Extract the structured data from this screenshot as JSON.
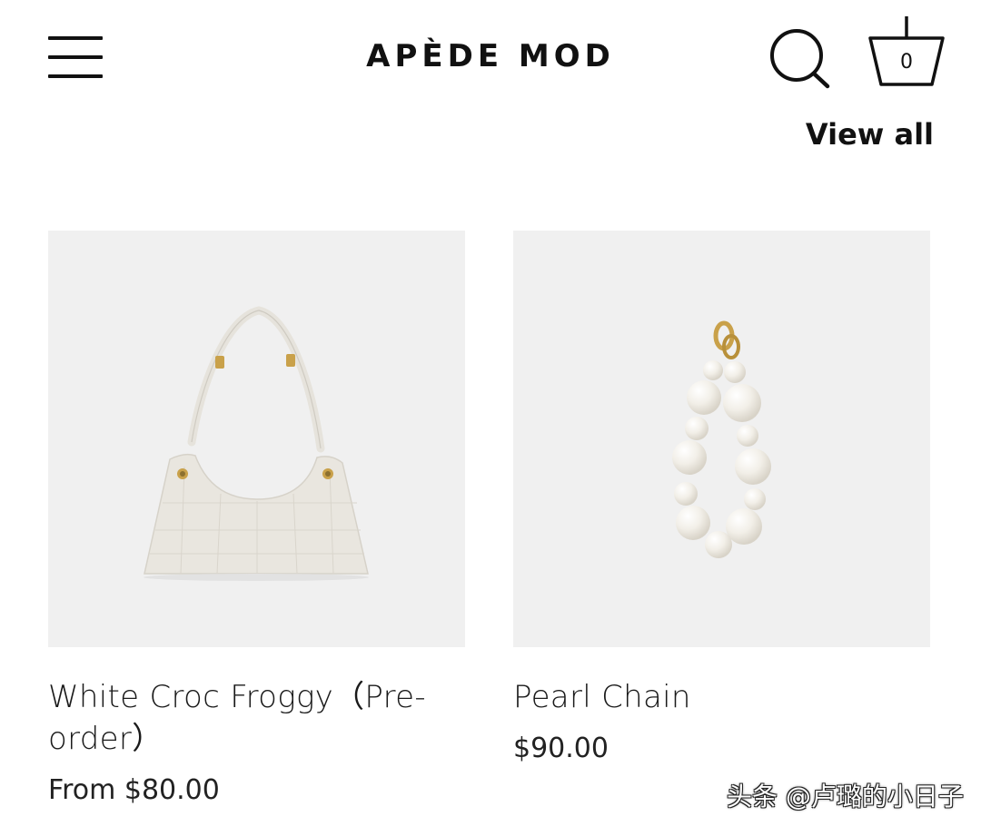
{
  "header": {
    "logo": "APÈDE MOD",
    "cart_count": "0",
    "menu_icon": "hamburger-menu-icon",
    "search_icon": "search-icon",
    "cart_icon": "basket-icon"
  },
  "view_all_label": "View all",
  "products": [
    {
      "name": "White Croc Froggy（Pre-order）",
      "price": "From $80.00",
      "image": "white-croc-shoulder-bag"
    },
    {
      "name": "Pearl Chain",
      "price": "$90.00",
      "image": "pearl-bag-chain"
    }
  ],
  "watermark": "头条 @卢璐的小日子",
  "colors": {
    "text": "#111111",
    "card_background": "#f0f0f0",
    "background": "#ffffff"
  }
}
